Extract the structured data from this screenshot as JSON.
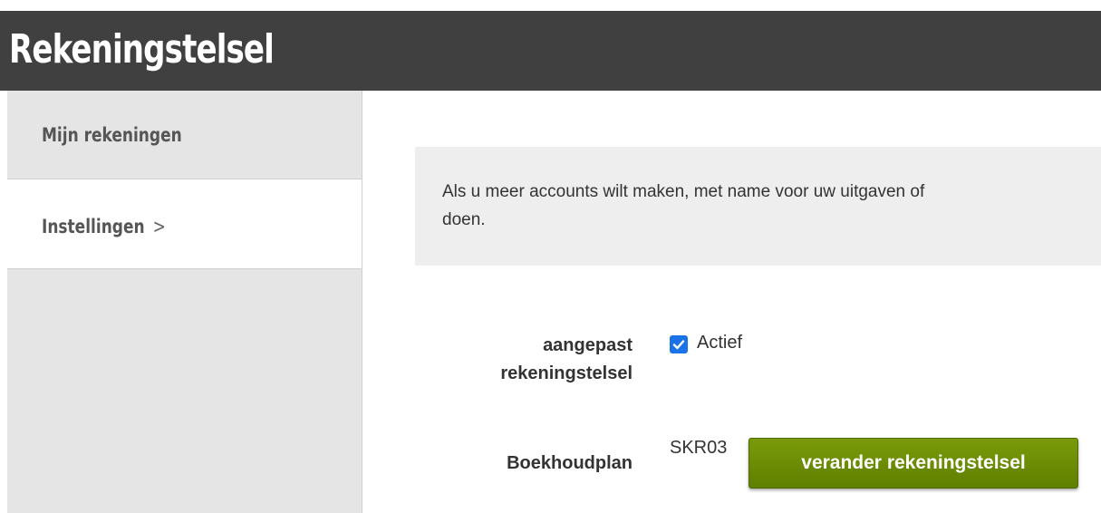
{
  "header": {
    "title": "Rekeningstelsel"
  },
  "sidebar": {
    "items": [
      {
        "label": "Mijn rekeningen"
      },
      {
        "label": "Instellingen",
        "chevron": ">"
      }
    ]
  },
  "info": {
    "line1": "Als u meer accounts wilt maken, met name voor uw uitgaven of",
    "line2": "doen."
  },
  "form": {
    "custom_plan_label_line1": "aangepast",
    "custom_plan_label_line2": "rekeningstelsel",
    "active_checkbox": {
      "checked": true,
      "label": "Actief"
    },
    "plan_label": "Boekhoudplan",
    "plan_value": "SKR03",
    "change_button": "verander rekeningstelsel"
  },
  "colors": {
    "header_bg": "#404040",
    "sidebar_bg": "#e5e5e5",
    "info_bg": "#eeeeee",
    "button_green": "#6a8a05",
    "checkbox_blue": "#1a73e8"
  }
}
